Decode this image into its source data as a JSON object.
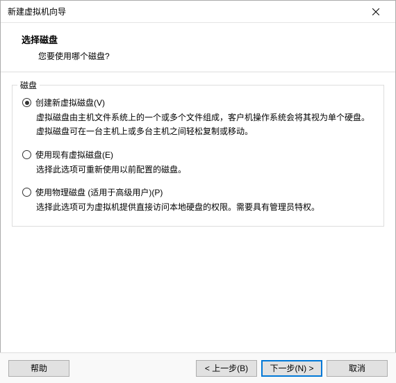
{
  "window": {
    "title": "新建虚拟机向导"
  },
  "header": {
    "title": "选择磁盘",
    "subtitle": "您要使用哪个磁盘?"
  },
  "group": {
    "legend": "磁盘",
    "options": [
      {
        "label": "创建新虚拟磁盘(V)",
        "desc": "虚拟磁盘由主机文件系统上的一个或多个文件组成，客户机操作系统会将其视为单个硬盘。虚拟磁盘可在一台主机上或多台主机之间轻松复制或移动。",
        "checked": true
      },
      {
        "label": "使用现有虚拟磁盘(E)",
        "desc": "选择此选项可重新使用以前配置的磁盘。",
        "checked": false
      },
      {
        "label": "使用物理磁盘 (适用于高级用户)(P)",
        "desc": "选择此选项可为虚拟机提供直接访问本地硬盘的权限。需要具有管理员特权。",
        "checked": false
      }
    ]
  },
  "footer": {
    "help": "帮助",
    "back": "< 上一步(B)",
    "next": "下一步(N) >",
    "cancel": "取消"
  }
}
